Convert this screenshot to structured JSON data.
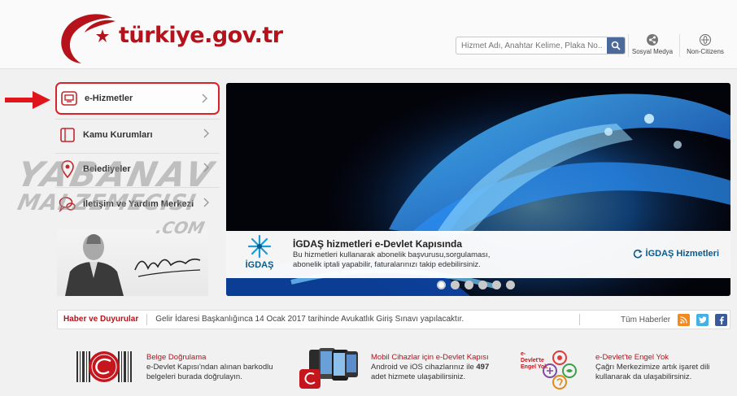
{
  "header": {
    "logo_text": "türkiye.gov.tr",
    "search_placeholder": "Hizmet Adı, Anahtar Kelime, Plaka No...",
    "links": [
      {
        "label": "Sosyal Medya",
        "icon": "share-icon"
      },
      {
        "label": "Non-Citizens",
        "icon": "globe-icon"
      }
    ]
  },
  "sidebar": {
    "items": [
      {
        "label": "e-Hizmetler",
        "icon": "monitor-icon",
        "active": true
      },
      {
        "label": "Kamu Kurumları",
        "icon": "building-icon"
      },
      {
        "label": "Belediyeler",
        "icon": "map-pin-icon"
      },
      {
        "label": "İletişim ve Yardım Merkezi",
        "icon": "chat-icon"
      }
    ]
  },
  "watermark": {
    "line1": "YABANAV",
    "line2": "MALZEMECISI",
    "line3": ".COM"
  },
  "banner": {
    "logo_name": "İGDAŞ",
    "title": "İGDAŞ hizmetleri e-Devlet Kapısında",
    "description": "Bu hizmetleri kullanarak abonelik başvurusu,sorgulaması, abonelik iptali yapabilir, faturalarınızı takip edebilirsiniz.",
    "link_label": "İGDAŞ Hizmetleri",
    "slide_count": 6,
    "active_slide": 1
  },
  "news": {
    "label": "Haber ve Duyurular",
    "text": "Gelir İdaresi Başkanlığınca 14 Ocak 2017 tarihinde Avukatlık Giriş Sınavı yapılacaktır.",
    "all_label": "Tüm Haberler",
    "social": [
      {
        "name": "rss-icon",
        "color": "#f28a20"
      },
      {
        "name": "twitter-icon",
        "color": "#45b0e3"
      },
      {
        "name": "facebook-icon",
        "color": "#3b5a9a"
      }
    ]
  },
  "features": [
    {
      "title": "Belge Doğrulama",
      "desc1": "e-Devlet Kapısı'ndan alınan barkodlu",
      "desc2": "belgeleri burada doğrulayın."
    },
    {
      "title": "Mobil Cihazlar için e-Devlet Kapısı",
      "desc1": "Android ve iOS cihazlarınız ile",
      "desc1_num": "497",
      "desc2": "adet hizmete ulaşabilirsiniz."
    },
    {
      "title": "e-Devlet'te Engel Yok",
      "desc1": "Çağrı Merkezimize artık işaret dili",
      "desc2": "kullanarak da ulaşabilirsiniz.",
      "badge": "e-Devlet'te Engel Yok"
    }
  ],
  "colors": {
    "brand": "#b5121b",
    "highlight": "#d8232a",
    "link": "#0b5b8a"
  }
}
